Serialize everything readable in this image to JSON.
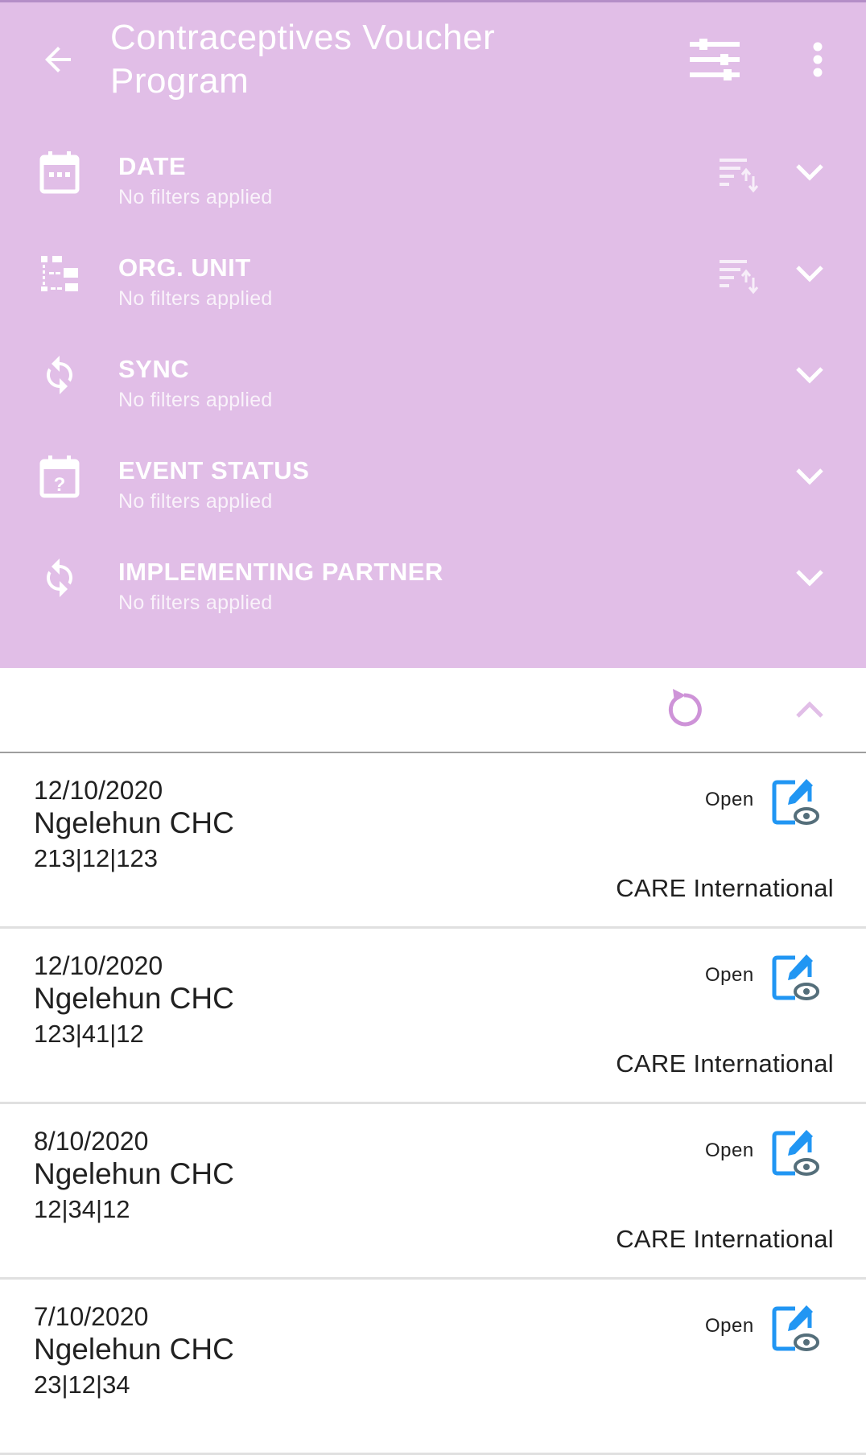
{
  "colors": {
    "header_bg": "#e1bee7",
    "accent": "#e1bee7",
    "edit_icon": "#2196f3",
    "text": "#212121"
  },
  "toolbar": {
    "title": "Contraceptives Voucher Program",
    "back_icon": "arrow-left-icon",
    "filter_icon": "filter-sliders-icon",
    "more_icon": "more-vert-icon"
  },
  "filters": [
    {
      "title": "DATE",
      "subtitle": "No filters applied",
      "icon": "calendar-icon",
      "sortable": true
    },
    {
      "title": "ORG. UNIT",
      "subtitle": "No filters applied",
      "icon": "org-tree-icon",
      "sortable": true
    },
    {
      "title": "SYNC",
      "subtitle": "No filters applied",
      "icon": "sync-icon",
      "sortable": false
    },
    {
      "title": "EVENT STATUS",
      "subtitle": "No filters applied",
      "icon": "calendar-question-icon",
      "sortable": false
    },
    {
      "title": "IMPLEMENTING PARTNER",
      "subtitle": "No filters applied",
      "icon": "sync-icon",
      "sortable": false
    }
  ],
  "events": [
    {
      "date": "12/10/2020",
      "org_unit": "Ngelehun CHC",
      "values": "213|12|123",
      "status": "Open",
      "partner": "CARE International"
    },
    {
      "date": "12/10/2020",
      "org_unit": "Ngelehun CHC",
      "values": "123|41|12",
      "status": "Open",
      "partner": "CARE International"
    },
    {
      "date": "8/10/2020",
      "org_unit": "Ngelehun CHC",
      "values": "12|34|12",
      "status": "Open",
      "partner": "CARE International"
    },
    {
      "date": "7/10/2020",
      "org_unit": "Ngelehun CHC",
      "values": "23|12|34",
      "status": "Open",
      "partner": ""
    }
  ]
}
